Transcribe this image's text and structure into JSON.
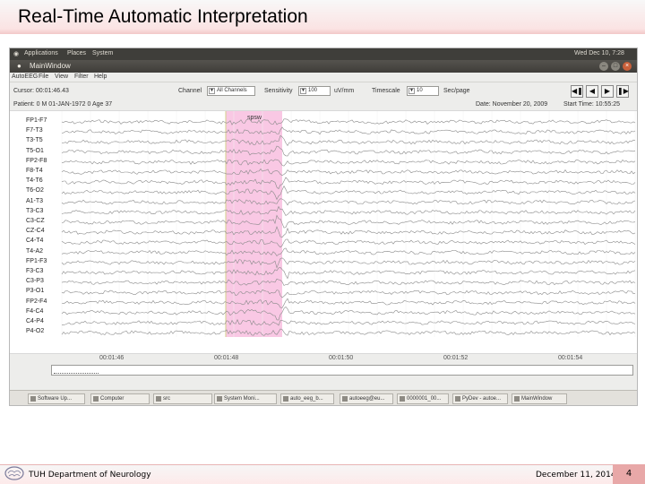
{
  "slide": {
    "title": "Real-Time Automatic Interpretation",
    "footer_left": "TUH Department of Neurology",
    "footer_date": "December 11, 2014",
    "page_number": "4"
  },
  "system_bar": {
    "applications": "Applications",
    "places": "Places",
    "system": "System",
    "clock": "Wed Dec 10, 7:28"
  },
  "window": {
    "title": "MainWindow"
  },
  "menu": [
    "AutoEEG",
    "File",
    "View",
    "Filter",
    "Help"
  ],
  "controls": {
    "cursor_label": "Cursor: 00:01:46.43",
    "channel_label": "Channel",
    "channel_value": "All Channels",
    "sensitivity_label": "Sensitivity",
    "sensitivity_value": "100",
    "sensitivity_unit": "uV/mm",
    "timescale_label": "Timescale",
    "timescale_value": "10",
    "timescale_unit": "Sec/page"
  },
  "nav_buttons": [
    "first-icon",
    "prev-icon",
    "next-icon",
    "last-icon"
  ],
  "info": {
    "patient": "Patient: 0 M 01-JAN-1972 0 Age 37",
    "date": "Date: November 20, 2009",
    "start_time": "Start Time: 10:55:25"
  },
  "annotation": {
    "label": "spsw",
    "color": "#f9c8e4"
  },
  "channels": [
    "FP1-F7",
    "F7-T3",
    "T3-T5",
    "T5-O1",
    "FP2-F8",
    "F8-T4",
    "T4-T6",
    "T6-O2",
    "A1-T3",
    "T3-C3",
    "C3-CZ",
    "CZ-C4",
    "C4-T4",
    "T4-A2",
    "FP1-F3",
    "F3-C3",
    "C3-P3",
    "P3-O1",
    "FP2-F4",
    "F4-C4",
    "C4-P4",
    "P4-O2"
  ],
  "time_ticks": [
    "00:01:46",
    "00:01:48",
    "00:01:50",
    "00:01:52",
    "00:01:54"
  ],
  "taskbar": [
    "Software Up...",
    "Computer",
    "src",
    "System Moni...",
    "auto_eeg_b...",
    "autoeeg@eu...",
    "0000001_00...",
    "PyDev - autoe...",
    "MainWindow"
  ]
}
